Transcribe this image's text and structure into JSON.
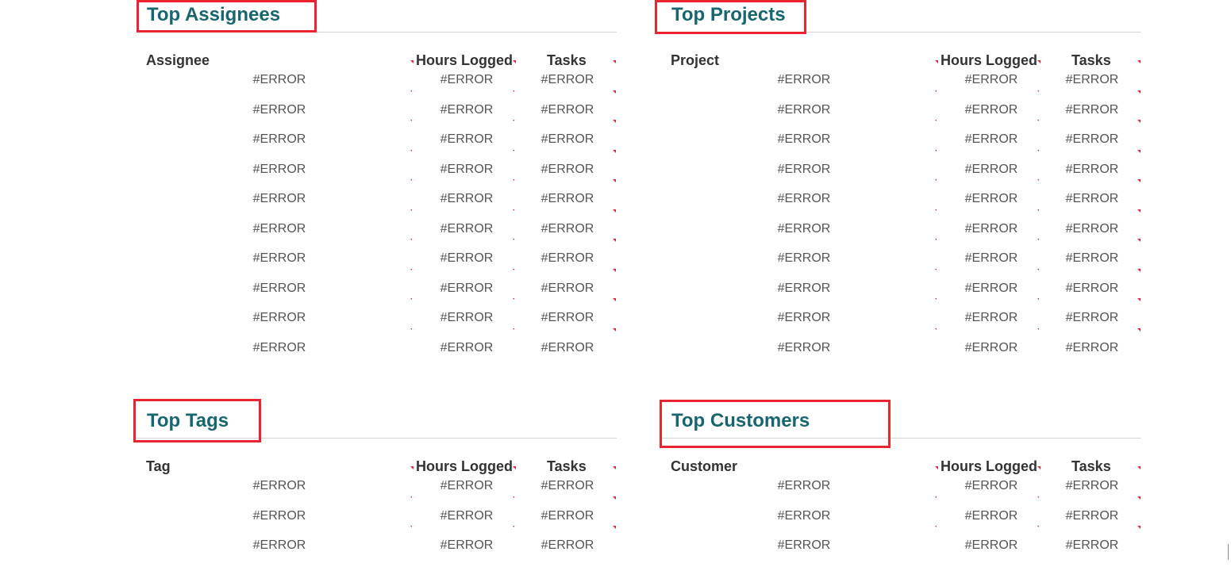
{
  "sections": [
    {
      "title": "Top Assignees",
      "headers": {
        "name": "Assignee",
        "hours": "Hours Logged",
        "tasks": "Tasks"
      },
      "rows": [
        [
          "#ERROR",
          "#ERROR",
          "#ERROR"
        ],
        [
          "#ERROR",
          "#ERROR",
          "#ERROR"
        ],
        [
          "#ERROR",
          "#ERROR",
          "#ERROR"
        ],
        [
          "#ERROR",
          "#ERROR",
          "#ERROR"
        ],
        [
          "#ERROR",
          "#ERROR",
          "#ERROR"
        ],
        [
          "#ERROR",
          "#ERROR",
          "#ERROR"
        ],
        [
          "#ERROR",
          "#ERROR",
          "#ERROR"
        ],
        [
          "#ERROR",
          "#ERROR",
          "#ERROR"
        ],
        [
          "#ERROR",
          "#ERROR",
          "#ERROR"
        ],
        [
          "#ERROR",
          "#ERROR",
          "#ERROR"
        ]
      ]
    },
    {
      "title": "Top Projects",
      "headers": {
        "name": "Project",
        "hours": "Hours Logged",
        "tasks": "Tasks"
      },
      "rows": [
        [
          "#ERROR",
          "#ERROR",
          "#ERROR"
        ],
        [
          "#ERROR",
          "#ERROR",
          "#ERROR"
        ],
        [
          "#ERROR",
          "#ERROR",
          "#ERROR"
        ],
        [
          "#ERROR",
          "#ERROR",
          "#ERROR"
        ],
        [
          "#ERROR",
          "#ERROR",
          "#ERROR"
        ],
        [
          "#ERROR",
          "#ERROR",
          "#ERROR"
        ],
        [
          "#ERROR",
          "#ERROR",
          "#ERROR"
        ],
        [
          "#ERROR",
          "#ERROR",
          "#ERROR"
        ],
        [
          "#ERROR",
          "#ERROR",
          "#ERROR"
        ],
        [
          "#ERROR",
          "#ERROR",
          "#ERROR"
        ]
      ]
    },
    {
      "title": "Top Tags",
      "headers": {
        "name": "Tag",
        "hours": "Hours Logged",
        "tasks": "Tasks"
      },
      "rows": [
        [
          "#ERROR",
          "#ERROR",
          "#ERROR"
        ],
        [
          "#ERROR",
          "#ERROR",
          "#ERROR"
        ],
        [
          "#ERROR",
          "#ERROR",
          "#ERROR"
        ]
      ]
    },
    {
      "title": "Top Customers",
      "headers": {
        "name": "Customer",
        "hours": "Hours Logged",
        "tasks": "Tasks"
      },
      "rows": [
        [
          "#ERROR",
          "#ERROR",
          "#ERROR"
        ],
        [
          "#ERROR",
          "#ERROR",
          "#ERROR"
        ],
        [
          "#ERROR",
          "#ERROR",
          "#ERROR"
        ]
      ]
    }
  ],
  "colors": {
    "title": "#17666f",
    "highlight": "#e8242f",
    "error_marker": "#e8242f"
  }
}
